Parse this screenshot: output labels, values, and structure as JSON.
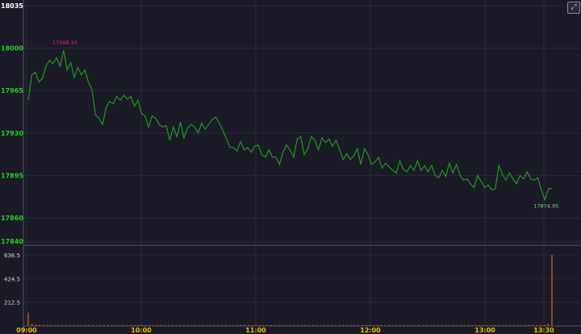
{
  "toolbar": {
    "zoom_icon": "magnifier-icon",
    "zoom_glyph": "⤢"
  },
  "colors": {
    "background": "#1b1a27",
    "price_line": "#1f9a1f",
    "price_axis": "#22d022",
    "volume_bar": "#d2661e",
    "high_label": "#e0206a",
    "low_label": "#7fd37f",
    "time_axis": "#e6c200",
    "grid": "#2c2b3a"
  },
  "chart_data": [
    {
      "type": "line",
      "series": [
        {
          "values": [
            17957,
            17978,
            17980,
            17972,
            17975,
            17985,
            17990,
            17987,
            17992,
            17985,
            17998.33,
            17982,
            17988,
            17976,
            17984,
            17978,
            17982,
            17972,
            17966,
            17945,
            17942,
            17937,
            17951,
            17956,
            17954,
            17960,
            17957,
            17961,
            17958,
            17960,
            17952,
            17957,
            17946,
            17944,
            17935,
            17944,
            17942,
            17937,
            17935,
            17936,
            17924,
            17935,
            17927,
            17939,
            17926,
            17934,
            17937,
            17935,
            17930,
            17938,
            17933,
            17937,
            17941,
            17943,
            17938,
            17932,
            17925,
            17918,
            17918,
            17915,
            17923,
            17916,
            17918,
            17914,
            17919,
            17920,
            17912,
            17910,
            17916,
            17910,
            17910,
            17904,
            17914,
            17920,
            17916,
            17910,
            17925,
            17927,
            17912,
            17917,
            17927,
            17924,
            17916,
            17926,
            17922,
            17925,
            17919,
            17924,
            17916,
            17908,
            17913,
            17908,
            17911,
            17917,
            17904,
            17917,
            17912,
            17904,
            17906,
            17910,
            17901,
            17905,
            17902,
            17899,
            17897,
            17907,
            17900,
            17898,
            17903,
            17899,
            17907,
            17899,
            17903,
            17898,
            17903,
            17895,
            17893,
            17899,
            17894,
            17905,
            17897,
            17904,
            17895,
            17891,
            17892,
            17888,
            17885,
            17895,
            17890,
            17885,
            17887,
            17883,
            17884,
            17903,
            17896,
            17891,
            17897,
            17892,
            17888,
            17895,
            17892,
            17898,
            17892,
            17891,
            17893,
            17883,
            17874.95,
            17884,
            17884
          ]
        }
      ],
      "ylim": [
        17840,
        18035
      ],
      "y_ticks": [
        "18035",
        "18000",
        "17965",
        "17930",
        "17895",
        "17860",
        "17840"
      ],
      "annotations": {
        "high": "17998.33",
        "low": "17874.95"
      },
      "grid": true
    },
    {
      "type": "bar",
      "series": [
        {
          "values": [
            120,
            18,
            12,
            10,
            10,
            9,
            9,
            8,
            9,
            8,
            10,
            8,
            9,
            8,
            8,
            9,
            10,
            9,
            8,
            9,
            8,
            9,
            9,
            8,
            8,
            9,
            8,
            9,
            8,
            9,
            9,
            8,
            9,
            8,
            8,
            9,
            8,
            9,
            9,
            8,
            8,
            9,
            8,
            9,
            9,
            8,
            9,
            8,
            8,
            9,
            9,
            8,
            9,
            8,
            8,
            9,
            8,
            8,
            9,
            8,
            9,
            9,
            8,
            8,
            9,
            8,
            9,
            8,
            8,
            9,
            9,
            8,
            8,
            9,
            8,
            9,
            8,
            9,
            9,
            8,
            8,
            9,
            8,
            9,
            8,
            8,
            9,
            9,
            8,
            8,
            9,
            8,
            9,
            8,
            8,
            9,
            8,
            9,
            8,
            9,
            9,
            8,
            8,
            9,
            8,
            9,
            8,
            8,
            9,
            9,
            8,
            8,
            9,
            8,
            9,
            8,
            9,
            8,
            9,
            9,
            8,
            8,
            9,
            8,
            9,
            8,
            8,
            9,
            9,
            8,
            8,
            9,
            8,
            9,
            8,
            9,
            10,
            20,
            636.5
          ]
        }
      ],
      "ylim": [
        0,
        650
      ],
      "y_ticks": [
        "636.5",
        "424.5",
        "212.5"
      ],
      "x_ticks": [
        "09:00",
        "10:00",
        "11:00",
        "12:00",
        "13:00",
        "13:30"
      ]
    }
  ]
}
